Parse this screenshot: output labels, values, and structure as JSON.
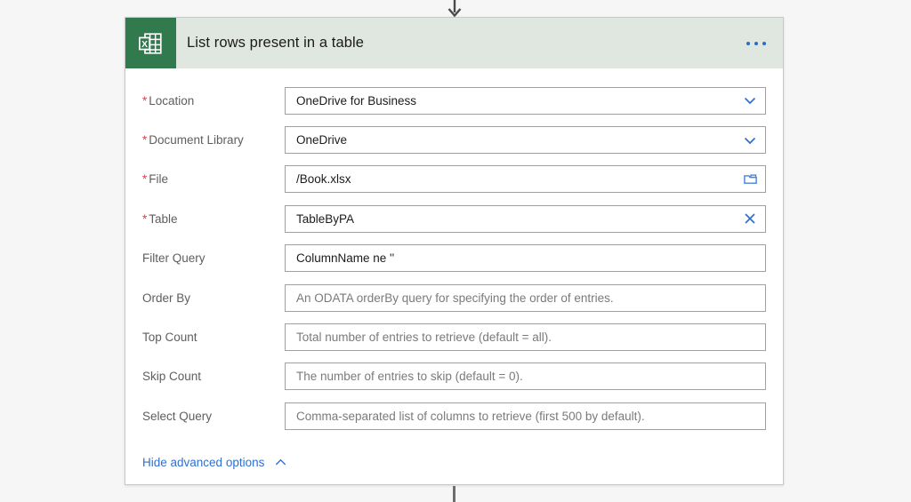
{
  "connectors": {
    "top_arrow_icon": "arrow-down-icon",
    "bottom_line": "vertical-connector-line"
  },
  "card": {
    "header": {
      "app_icon": "excel-icon",
      "title": "List rows present in a table",
      "menu_icon": "ellipsis-horizontal-icon",
      "background_color": "#dfe7e0",
      "icon_background_color": "#317a4d"
    },
    "fields": [
      {
        "label": "Location",
        "required": true,
        "value": "OneDrive for Business",
        "placeholder": "",
        "icon": "chevron-down-icon"
      },
      {
        "label": "Document Library",
        "required": true,
        "value": "OneDrive",
        "placeholder": "",
        "icon": "chevron-down-icon"
      },
      {
        "label": "File",
        "required": true,
        "value": "/Book.xlsx",
        "placeholder": "",
        "icon": "folder-icon"
      },
      {
        "label": "Table",
        "required": true,
        "value": "TableByPA",
        "placeholder": "",
        "icon": "close-x-icon"
      },
      {
        "label": "Filter Query",
        "required": false,
        "value": "ColumnName ne ''",
        "placeholder": "",
        "icon": "none"
      },
      {
        "label": "Order By",
        "required": false,
        "value": "",
        "placeholder": "An ODATA orderBy query for specifying the order of entries.",
        "icon": "none"
      },
      {
        "label": "Top Count",
        "required": false,
        "value": "",
        "placeholder": "Total number of entries to retrieve (default = all).",
        "icon": "none"
      },
      {
        "label": "Skip Count",
        "required": false,
        "value": "",
        "placeholder": "The number of entries to skip (default = 0).",
        "icon": "none"
      },
      {
        "label": "Select Query",
        "required": false,
        "value": "",
        "placeholder": "Comma-separated list of columns to retrieve (first 500 by default).",
        "icon": "none"
      }
    ],
    "advanced_options": {
      "label": "Hide advanced options",
      "icon": "chevron-up-icon",
      "link_color": "#2f6fd0"
    }
  },
  "colors": {
    "page_background": "#f6f6f6",
    "required_asterisk": "#d9414b",
    "accent_blue": "#2f6fd0",
    "label_gray": "#605e5c",
    "placeholder_gray": "#7a7a7a"
  }
}
